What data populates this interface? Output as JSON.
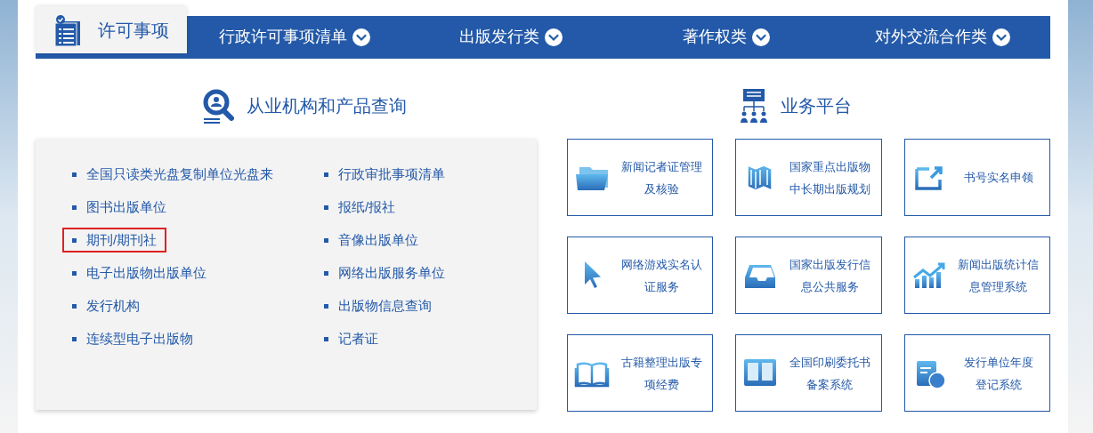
{
  "tabs": [
    {
      "label": "许可事项",
      "selected": true
    },
    {
      "label": "行政许可事项清单",
      "selected": false
    },
    {
      "label": "出版发行类",
      "selected": false
    },
    {
      "label": "著作权类",
      "selected": false
    },
    {
      "label": "对外交流合作类",
      "selected": false
    }
  ],
  "query_section": {
    "title": "从业机构和产品查询",
    "columns": [
      [
        {
          "label": "全国只读类光盘复制单位光盘来",
          "highlighted": false
        },
        {
          "label": "图书出版单位",
          "highlighted": false
        },
        {
          "label": "期刊/期刊社",
          "highlighted": true
        },
        {
          "label": "电子出版物出版单位",
          "highlighted": false
        },
        {
          "label": "发行机构",
          "highlighted": false
        },
        {
          "label": "连续型电子出版物",
          "highlighted": false
        }
      ],
      [
        {
          "label": "行政审批事项清单",
          "highlighted": false
        },
        {
          "label": "报纸/报社",
          "highlighted": false
        },
        {
          "label": "音像出版单位",
          "highlighted": false
        },
        {
          "label": "网络出版服务单位",
          "highlighted": false
        },
        {
          "label": "出版物信息查询",
          "highlighted": false
        },
        {
          "label": "记者证",
          "highlighted": false
        }
      ]
    ]
  },
  "platform_section": {
    "title": "业务平台",
    "cards": [
      {
        "kind": "folder",
        "label_lines": [
          "新闻记者证管理",
          "及核验"
        ]
      },
      {
        "kind": "map",
        "label_lines": [
          "国家重点出版物",
          "中长期出版规划"
        ]
      },
      {
        "kind": "share",
        "label_lines": [
          "书号实名申领"
        ]
      },
      {
        "kind": "cursor",
        "label_lines": [
          "网络游戏实名认",
          "证服务"
        ]
      },
      {
        "kind": "tray",
        "label_lines": [
          "国家出版发行信",
          "息公共服务"
        ]
      },
      {
        "kind": "chart",
        "label_lines": [
          "新闻出版统计信",
          "息管理系统"
        ]
      },
      {
        "kind": "book",
        "label_lines": [
          "古籍整理出版专",
          "项经费"
        ]
      },
      {
        "kind": "seal",
        "label_lines": [
          "全国印刷委托书",
          "备案系统"
        ]
      },
      {
        "kind": "calendar",
        "label_lines": [
          "发行单位年度",
          "登记系统"
        ]
      }
    ]
  }
}
